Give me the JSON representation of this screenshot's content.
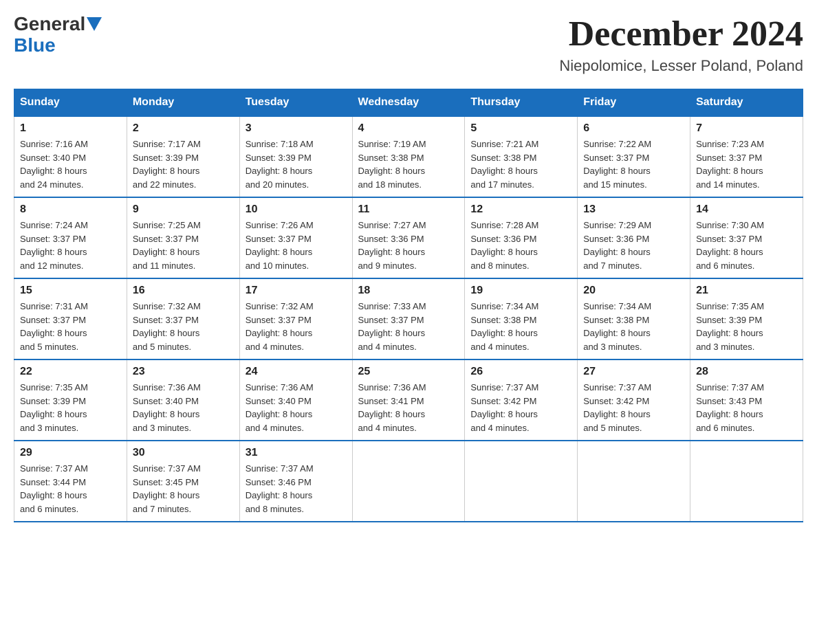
{
  "logo": {
    "text_general": "General",
    "text_blue": "Blue"
  },
  "title": "December 2024",
  "subtitle": "Niepolomice, Lesser Poland, Poland",
  "days_of_week": [
    "Sunday",
    "Monday",
    "Tuesday",
    "Wednesday",
    "Thursday",
    "Friday",
    "Saturday"
  ],
  "weeks": [
    [
      {
        "day": "1",
        "sunrise": "7:16 AM",
        "sunset": "3:40 PM",
        "daylight": "8 hours and 24 minutes."
      },
      {
        "day": "2",
        "sunrise": "7:17 AM",
        "sunset": "3:39 PM",
        "daylight": "8 hours and 22 minutes."
      },
      {
        "day": "3",
        "sunrise": "7:18 AM",
        "sunset": "3:39 PM",
        "daylight": "8 hours and 20 minutes."
      },
      {
        "day": "4",
        "sunrise": "7:19 AM",
        "sunset": "3:38 PM",
        "daylight": "8 hours and 18 minutes."
      },
      {
        "day": "5",
        "sunrise": "7:21 AM",
        "sunset": "3:38 PM",
        "daylight": "8 hours and 17 minutes."
      },
      {
        "day": "6",
        "sunrise": "7:22 AM",
        "sunset": "3:37 PM",
        "daylight": "8 hours and 15 minutes."
      },
      {
        "day": "7",
        "sunrise": "7:23 AM",
        "sunset": "3:37 PM",
        "daylight": "8 hours and 14 minutes."
      }
    ],
    [
      {
        "day": "8",
        "sunrise": "7:24 AM",
        "sunset": "3:37 PM",
        "daylight": "8 hours and 12 minutes."
      },
      {
        "day": "9",
        "sunrise": "7:25 AM",
        "sunset": "3:37 PM",
        "daylight": "8 hours and 11 minutes."
      },
      {
        "day": "10",
        "sunrise": "7:26 AM",
        "sunset": "3:37 PM",
        "daylight": "8 hours and 10 minutes."
      },
      {
        "day": "11",
        "sunrise": "7:27 AM",
        "sunset": "3:36 PM",
        "daylight": "8 hours and 9 minutes."
      },
      {
        "day": "12",
        "sunrise": "7:28 AM",
        "sunset": "3:36 PM",
        "daylight": "8 hours and 8 minutes."
      },
      {
        "day": "13",
        "sunrise": "7:29 AM",
        "sunset": "3:36 PM",
        "daylight": "8 hours and 7 minutes."
      },
      {
        "day": "14",
        "sunrise": "7:30 AM",
        "sunset": "3:37 PM",
        "daylight": "8 hours and 6 minutes."
      }
    ],
    [
      {
        "day": "15",
        "sunrise": "7:31 AM",
        "sunset": "3:37 PM",
        "daylight": "8 hours and 5 minutes."
      },
      {
        "day": "16",
        "sunrise": "7:32 AM",
        "sunset": "3:37 PM",
        "daylight": "8 hours and 5 minutes."
      },
      {
        "day": "17",
        "sunrise": "7:32 AM",
        "sunset": "3:37 PM",
        "daylight": "8 hours and 4 minutes."
      },
      {
        "day": "18",
        "sunrise": "7:33 AM",
        "sunset": "3:37 PM",
        "daylight": "8 hours and 4 minutes."
      },
      {
        "day": "19",
        "sunrise": "7:34 AM",
        "sunset": "3:38 PM",
        "daylight": "8 hours and 4 minutes."
      },
      {
        "day": "20",
        "sunrise": "7:34 AM",
        "sunset": "3:38 PM",
        "daylight": "8 hours and 3 minutes."
      },
      {
        "day": "21",
        "sunrise": "7:35 AM",
        "sunset": "3:39 PM",
        "daylight": "8 hours and 3 minutes."
      }
    ],
    [
      {
        "day": "22",
        "sunrise": "7:35 AM",
        "sunset": "3:39 PM",
        "daylight": "8 hours and 3 minutes."
      },
      {
        "day": "23",
        "sunrise": "7:36 AM",
        "sunset": "3:40 PM",
        "daylight": "8 hours and 3 minutes."
      },
      {
        "day": "24",
        "sunrise": "7:36 AM",
        "sunset": "3:40 PM",
        "daylight": "8 hours and 4 minutes."
      },
      {
        "day": "25",
        "sunrise": "7:36 AM",
        "sunset": "3:41 PM",
        "daylight": "8 hours and 4 minutes."
      },
      {
        "day": "26",
        "sunrise": "7:37 AM",
        "sunset": "3:42 PM",
        "daylight": "8 hours and 4 minutes."
      },
      {
        "day": "27",
        "sunrise": "7:37 AM",
        "sunset": "3:42 PM",
        "daylight": "8 hours and 5 minutes."
      },
      {
        "day": "28",
        "sunrise": "7:37 AM",
        "sunset": "3:43 PM",
        "daylight": "8 hours and 6 minutes."
      }
    ],
    [
      {
        "day": "29",
        "sunrise": "7:37 AM",
        "sunset": "3:44 PM",
        "daylight": "8 hours and 6 minutes."
      },
      {
        "day": "30",
        "sunrise": "7:37 AM",
        "sunset": "3:45 PM",
        "daylight": "8 hours and 7 minutes."
      },
      {
        "day": "31",
        "sunrise": "7:37 AM",
        "sunset": "3:46 PM",
        "daylight": "8 hours and 8 minutes."
      },
      null,
      null,
      null,
      null
    ]
  ],
  "labels": {
    "sunrise": "Sunrise:",
    "sunset": "Sunset:",
    "daylight": "Daylight:"
  }
}
